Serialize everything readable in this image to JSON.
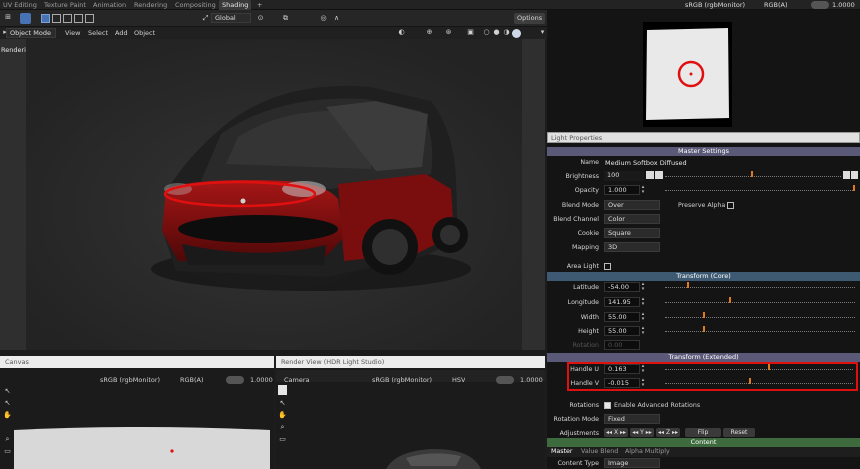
{
  "workspace_tabs": [
    "UV Editing",
    "Texture Paint",
    "Animation",
    "Rendering",
    "Compositing",
    "Shading"
  ],
  "active_tab": "Shading",
  "top_right": {
    "color_space": "sRGB (rgbMonitor)",
    "channels": "RGB(A)",
    "exposure": "1.0000"
  },
  "toolbar": {
    "transform_orientation": "Global",
    "options_label": "Options"
  },
  "viewport_header": {
    "mode": "Object Mode",
    "menus": [
      "View",
      "Select",
      "Add",
      "Object"
    ]
  },
  "viewport": {
    "status": "Rendering Done"
  },
  "light_properties": {
    "title": "Light Properties",
    "sections": {
      "master": "Master Settings",
      "transform_core": "Transform (Core)",
      "transform_extended": "Transform (Extended)",
      "content": "Content"
    },
    "name_label": "Name",
    "name_value": "Medium Softbox Diffused",
    "brightness_label": "Brightness",
    "brightness_value": "100",
    "opacity_label": "Opacity",
    "opacity_value": "1.000",
    "blend_mode_label": "Blend Mode",
    "blend_mode_value": "Over",
    "preserve_alpha_label": "Preserve Alpha",
    "blend_channel_label": "Blend Channel",
    "blend_channel_value": "Color",
    "cookie_label": "Cookie",
    "cookie_value": "Square",
    "mapping_label": "Mapping",
    "mapping_value": "3D",
    "area_light_label": "Area Light",
    "latitude_label": "Latitude",
    "latitude_value": "-54.00",
    "longitude_label": "Longitude",
    "longitude_value": "141.95",
    "width_label": "Width",
    "width_value": "55.00",
    "height_label": "Height",
    "height_value": "55.00",
    "rotation_label": "Rotation",
    "rotation_value": "0.00",
    "handle_u_label": "Handle U",
    "handle_u_value": "0.163",
    "handle_v_label": "Handle V",
    "handle_v_value": "-0.015",
    "rotations_label": "Rotations",
    "enable_adv_rotations_label": "Enable Advanced Rotations",
    "rotation_mode_label": "Rotation Mode",
    "rotation_mode_value": "Fixed",
    "adjustments_label": "Adjustments",
    "adj_x": "X",
    "adj_y": "Y",
    "adj_z": "Z",
    "flip_label": "Flip",
    "reset_label": "Reset",
    "content_tabs": [
      "Master",
      "Value Blend",
      "Alpha Multiply"
    ],
    "content_type_label": "Content Type",
    "content_type_value": "Image"
  },
  "canvas_panel": {
    "title": "Canvas",
    "color_space": "sRGB (rgbMonitor)",
    "channels": "RGB(A)",
    "exposure": "1.0000"
  },
  "render_view_panel": {
    "title": "Render View (HDR Light Studio)",
    "camera": "Camera",
    "color_space": "sRGB (rgbMonitor)",
    "mode": "HSV",
    "exposure": "1.0000"
  },
  "colors": {
    "highlight_red": "#e01010",
    "accent_blue": "#4772b3",
    "slider_orange": "#e07a1f",
    "car_body": "#8a1010"
  }
}
